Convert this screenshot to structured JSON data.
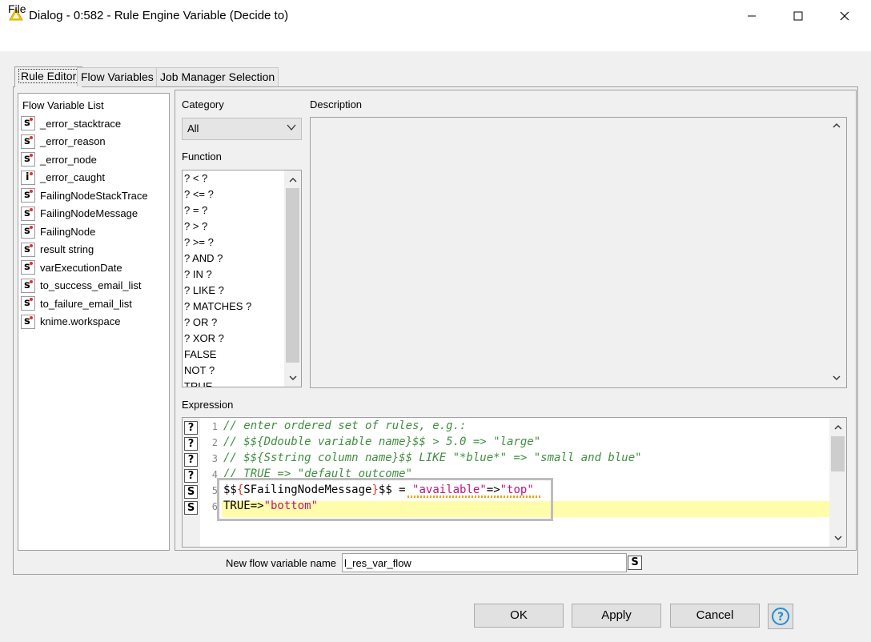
{
  "window": {
    "title": "Dialog - 0:582 - Rule Engine Variable (Decide to)"
  },
  "menu": {
    "file": "File"
  },
  "tabs": [
    {
      "label": "Rule Editor",
      "active": true
    },
    {
      "label": "Flow Variables",
      "active": false
    },
    {
      "label": "Job Manager Selection",
      "active": false
    }
  ],
  "flow_vars": {
    "header": "Flow Variable List",
    "items": [
      {
        "type": "s",
        "name": "_error_stacktrace"
      },
      {
        "type": "s",
        "name": "_error_reason"
      },
      {
        "type": "s",
        "name": "_error_node"
      },
      {
        "type": "i",
        "name": "_error_caught"
      },
      {
        "type": "s",
        "name": "FailingNodeStackTrace"
      },
      {
        "type": "s",
        "name": "FailingNodeMessage"
      },
      {
        "type": "s",
        "name": "FailingNode"
      },
      {
        "type": "s",
        "name": "result string"
      },
      {
        "type": "s",
        "name": "varExecutionDate"
      },
      {
        "type": "s",
        "name": "to_success_email_list"
      },
      {
        "type": "s",
        "name": "to_failure_email_list"
      },
      {
        "type": "s",
        "name": "knime.workspace"
      }
    ]
  },
  "category": {
    "label": "Category",
    "selected": "All"
  },
  "description": {
    "label": "Description"
  },
  "function": {
    "label": "Function",
    "items": [
      "? < ?",
      "? <= ?",
      "? = ?",
      "? > ?",
      "? >= ?",
      "? AND ?",
      "? IN ?",
      "? LIKE ?",
      "? MATCHES ?",
      "? OR ?",
      "? XOR ?",
      "FALSE",
      "NOT ?",
      "TRUE"
    ]
  },
  "expression": {
    "label": "Expression",
    "gutter": [
      "?",
      "?",
      "?",
      "?",
      "S",
      "S"
    ],
    "line_numbers": [
      "1",
      "2",
      "3",
      "4",
      "5",
      "6"
    ],
    "line1": "// enter ordered set of rules, e.g.:",
    "line2": "// $${Ddouble variable name}$$ > 5.0 => \"large\"",
    "line3": "// $${Sstring column name}$$ LIKE \"*blue*\" => \"small and blue\"",
    "line4": "// TRUE => \"default outcome\"",
    "line5_a": "$$",
    "line5_b": "{",
    "line5_c": "SFailingNodeMessage",
    "line5_d": "}",
    "line5_e": "$$ = ",
    "line5_f": "\"available\"",
    "line5_g": "=>",
    "line5_h": "\"top\"",
    "line6_a": "TRUE=>",
    "line6_b": "\"bottom\""
  },
  "new_var": {
    "label": "New flow variable name",
    "value": "l_res_var_flow",
    "type": "S"
  },
  "buttons": {
    "ok": "OK",
    "apply": "Apply",
    "cancel": "Cancel"
  },
  "colors": {
    "accent_help": "#1e8fd6",
    "comment": "#3f8f3f",
    "string": "#c0147f",
    "highlight": "#fffcaa"
  }
}
